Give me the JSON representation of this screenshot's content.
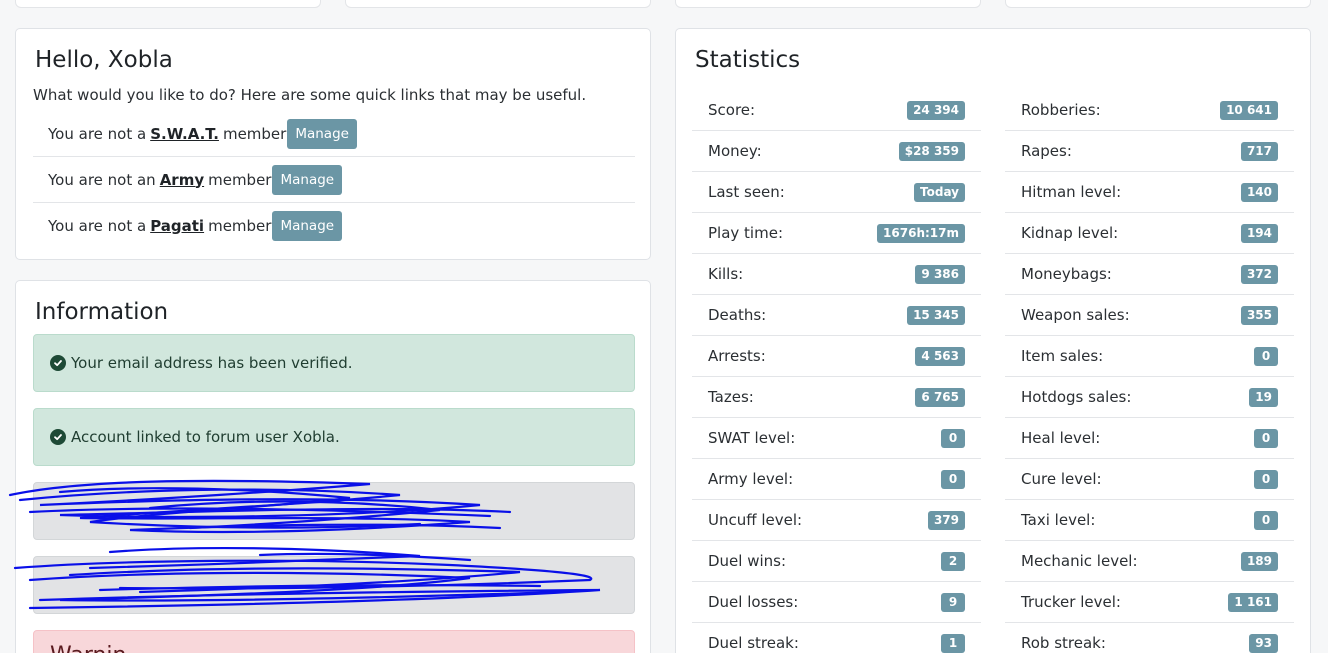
{
  "hello": {
    "title": "Hello, Xobla",
    "subtitle": "What would you like to do? Here are some quick links that may be useful.",
    "memberships": [
      {
        "prefix": "You are not a",
        "group": "S.W.A.T.",
        "suffix": "member",
        "button": "Manage"
      },
      {
        "prefix": "You are not an",
        "group": "Army",
        "suffix": "member",
        "button": "Manage"
      },
      {
        "prefix": "You are not a",
        "group": "Pagati",
        "suffix": "member",
        "button": "Manage"
      }
    ]
  },
  "info": {
    "title": "Information",
    "alerts": [
      {
        "text": "Your email address has been verified."
      },
      {
        "text": "Account linked to forum user Xobla."
      }
    ],
    "warning_title": "Warnin"
  },
  "stats": {
    "title": "Statistics",
    "left": [
      {
        "label": "Score:",
        "value": "24 394"
      },
      {
        "label": "Money:",
        "value": "$28 359"
      },
      {
        "label": "Last seen:",
        "value": "Today"
      },
      {
        "label": "Play time:",
        "value": "1676h:17m"
      },
      {
        "label": "Kills:",
        "value": "9 386"
      },
      {
        "label": "Deaths:",
        "value": "15 345"
      },
      {
        "label": "Arrests:",
        "value": "4 563"
      },
      {
        "label": "Tazes:",
        "value": "6 765"
      },
      {
        "label": "SWAT level:",
        "value": "0"
      },
      {
        "label": "Army level:",
        "value": "0"
      },
      {
        "label": "Uncuff level:",
        "value": "379"
      },
      {
        "label": "Duel wins:",
        "value": "2"
      },
      {
        "label": "Duel losses:",
        "value": "9"
      },
      {
        "label": "Duel streak:",
        "value": "1"
      }
    ],
    "right": [
      {
        "label": "Robberies:",
        "value": "10 641"
      },
      {
        "label": "Rapes:",
        "value": "717"
      },
      {
        "label": "Hitman level:",
        "value": "140"
      },
      {
        "label": "Kidnap level:",
        "value": "194"
      },
      {
        "label": "Moneybags:",
        "value": "372"
      },
      {
        "label": "Weapon sales:",
        "value": "355"
      },
      {
        "label": "Item sales:",
        "value": "0"
      },
      {
        "label": "Hotdogs sales:",
        "value": "19"
      },
      {
        "label": "Heal level:",
        "value": "0"
      },
      {
        "label": "Cure level:",
        "value": "0"
      },
      {
        "label": "Taxi level:",
        "value": "0"
      },
      {
        "label": "Mechanic level:",
        "value": "189"
      },
      {
        "label": "Trucker level:",
        "value": "1 161"
      },
      {
        "label": "Rob streak:",
        "value": "93"
      }
    ]
  },
  "colors": {
    "badge": "#6b96a5",
    "success_bg": "#d1e7dd",
    "scribble": "#0a10e8"
  }
}
